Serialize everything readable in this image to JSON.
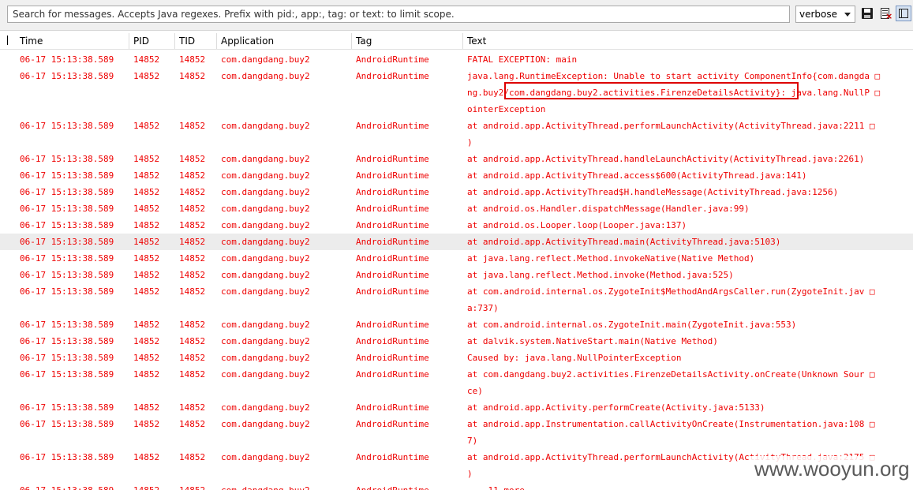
{
  "toolbar": {
    "search_placeholder": "Search for messages. Accepts Java regexes. Prefix with pid:, app:, tag: or text: to limit scope.",
    "log_level": "verbose",
    "icons": [
      "save-icon",
      "clear-log-icon",
      "scroll-lock-icon"
    ]
  },
  "columns": [
    "Time",
    "PID",
    "TID",
    "Application",
    "Tag",
    "Text"
  ],
  "rows": [
    {
      "time": "06-17 15:13:38.589",
      "pid": "14852",
      "tid": "14852",
      "app": "com.dangdang.buy2",
      "tag": "AndroidRuntime",
      "text": [
        "FATAL EXCEPTION: main"
      ]
    },
    {
      "time": "06-17 15:13:38.589",
      "pid": "14852",
      "tid": "14852",
      "app": "com.dangdang.buy2",
      "tag": "AndroidRuntime",
      "text": [
        "java.lang.RuntimeException: Unable to start activity ComponentInfo{com.dangda □",
        "ng.buy2/com.dangdang.buy2.activities.FirenzeDetailsActivity}: java.lang.NullP □",
        "ointerException"
      ]
    },
    {
      "time": "06-17 15:13:38.589",
      "pid": "14852",
      "tid": "14852",
      "app": "com.dangdang.buy2",
      "tag": "AndroidRuntime",
      "text": [
        "at android.app.ActivityThread.performLaunchActivity(ActivityThread.java:2211 □",
        ")"
      ]
    },
    {
      "time": "06-17 15:13:38.589",
      "pid": "14852",
      "tid": "14852",
      "app": "com.dangdang.buy2",
      "tag": "AndroidRuntime",
      "text": [
        "at android.app.ActivityThread.handleLaunchActivity(ActivityThread.java:2261)"
      ]
    },
    {
      "time": "06-17 15:13:38.589",
      "pid": "14852",
      "tid": "14852",
      "app": "com.dangdang.buy2",
      "tag": "AndroidRuntime",
      "text": [
        "at android.app.ActivityThread.access$600(ActivityThread.java:141)"
      ]
    },
    {
      "time": "06-17 15:13:38.589",
      "pid": "14852",
      "tid": "14852",
      "app": "com.dangdang.buy2",
      "tag": "AndroidRuntime",
      "text": [
        "at android.app.ActivityThread$H.handleMessage(ActivityThread.java:1256)"
      ]
    },
    {
      "time": "06-17 15:13:38.589",
      "pid": "14852",
      "tid": "14852",
      "app": "com.dangdang.buy2",
      "tag": "AndroidRuntime",
      "text": [
        "at android.os.Handler.dispatchMessage(Handler.java:99)"
      ]
    },
    {
      "time": "06-17 15:13:38.589",
      "pid": "14852",
      "tid": "14852",
      "app": "com.dangdang.buy2",
      "tag": "AndroidRuntime",
      "text": [
        "at android.os.Looper.loop(Looper.java:137)"
      ]
    },
    {
      "time": "06-17 15:13:38.589",
      "pid": "14852",
      "tid": "14852",
      "app": "com.dangdang.buy2",
      "tag": "AndroidRuntime",
      "text": [
        "at android.app.ActivityThread.main(ActivityThread.java:5103)"
      ],
      "selected": true
    },
    {
      "time": "06-17 15:13:38.589",
      "pid": "14852",
      "tid": "14852",
      "app": "com.dangdang.buy2",
      "tag": "AndroidRuntime",
      "text": [
        "at java.lang.reflect.Method.invokeNative(Native Method)"
      ]
    },
    {
      "time": "06-17 15:13:38.589",
      "pid": "14852",
      "tid": "14852",
      "app": "com.dangdang.buy2",
      "tag": "AndroidRuntime",
      "text": [
        "at java.lang.reflect.Method.invoke(Method.java:525)"
      ]
    },
    {
      "time": "06-17 15:13:38.589",
      "pid": "14852",
      "tid": "14852",
      "app": "com.dangdang.buy2",
      "tag": "AndroidRuntime",
      "text": [
        "at com.android.internal.os.ZygoteInit$MethodAndArgsCaller.run(ZygoteInit.jav □",
        "a:737)"
      ]
    },
    {
      "time": "06-17 15:13:38.589",
      "pid": "14852",
      "tid": "14852",
      "app": "com.dangdang.buy2",
      "tag": "AndroidRuntime",
      "text": [
        "at com.android.internal.os.ZygoteInit.main(ZygoteInit.java:553)"
      ]
    },
    {
      "time": "06-17 15:13:38.589",
      "pid": "14852",
      "tid": "14852",
      "app": "com.dangdang.buy2",
      "tag": "AndroidRuntime",
      "text": [
        "at dalvik.system.NativeStart.main(Native Method)"
      ]
    },
    {
      "time": "06-17 15:13:38.589",
      "pid": "14852",
      "tid": "14852",
      "app": "com.dangdang.buy2",
      "tag": "AndroidRuntime",
      "text": [
        "Caused by: java.lang.NullPointerException"
      ]
    },
    {
      "time": "06-17 15:13:38.589",
      "pid": "14852",
      "tid": "14852",
      "app": "com.dangdang.buy2",
      "tag": "AndroidRuntime",
      "text": [
        "at com.dangdang.buy2.activities.FirenzeDetailsActivity.onCreate(Unknown Sour □",
        "ce)"
      ]
    },
    {
      "time": "06-17 15:13:38.589",
      "pid": "14852",
      "tid": "14852",
      "app": "com.dangdang.buy2",
      "tag": "AndroidRuntime",
      "text": [
        "at android.app.Activity.performCreate(Activity.java:5133)"
      ]
    },
    {
      "time": "06-17 15:13:38.589",
      "pid": "14852",
      "tid": "14852",
      "app": "com.dangdang.buy2",
      "tag": "AndroidRuntime",
      "text": [
        "at android.app.Instrumentation.callActivityOnCreate(Instrumentation.java:108 □",
        "7)"
      ]
    },
    {
      "time": "06-17 15:13:38.589",
      "pid": "14852",
      "tid": "14852",
      "app": "com.dangdang.buy2",
      "tag": "AndroidRuntime",
      "text": [
        "at android.app.ActivityThread.performLaunchActivity(ActivityThread.java:2175 □",
        ")"
      ]
    },
    {
      "time": "06-17 15:13:38.589",
      "pid": "14852",
      "tid": "14852",
      "app": "com.dangdang.buy2",
      "tag": "AndroidRuntime",
      "text": [
        "... 11 more"
      ]
    }
  ],
  "watermark": "www.wooyun.org"
}
